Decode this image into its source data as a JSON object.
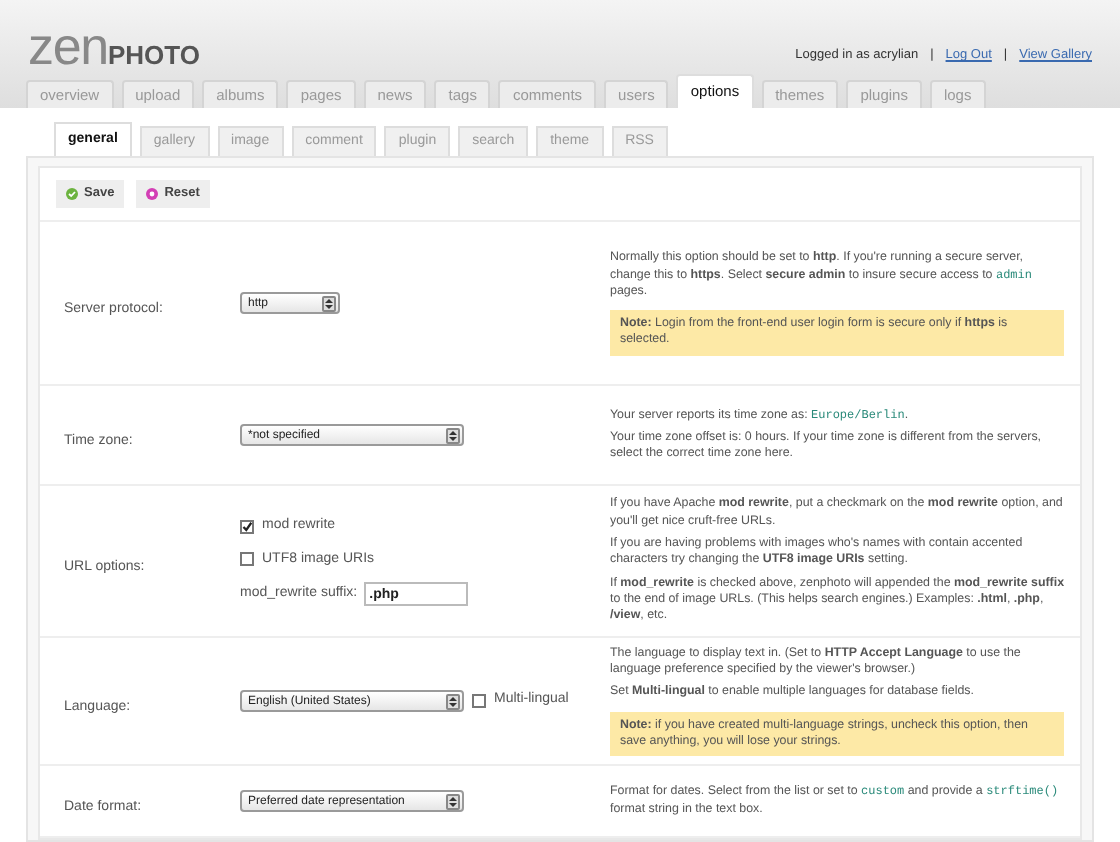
{
  "logo": {
    "part_1": "zen",
    "part_2": "PHOTO"
  },
  "user_bar": {
    "logged_in": "Logged in as acrylian",
    "separator_1": "|",
    "log_out": "Log Out",
    "separator_2": "|",
    "view_gallery": "View Gallery"
  },
  "tabs": [
    {
      "label": "overview",
      "selected": false
    },
    {
      "label": "upload",
      "selected": false
    },
    {
      "label": "albums",
      "selected": false
    },
    {
      "label": "pages",
      "selected": false
    },
    {
      "label": "news",
      "selected": false
    },
    {
      "label": "tags",
      "selected": false
    },
    {
      "label": "comments",
      "selected": false
    },
    {
      "label": "users",
      "selected": false
    },
    {
      "label": "options",
      "selected": true
    },
    {
      "label": "themes",
      "selected": false
    },
    {
      "label": "plugins",
      "selected": false
    },
    {
      "label": "logs",
      "selected": false
    }
  ],
  "subtabs": [
    {
      "label": "general",
      "selected": true
    },
    {
      "label": "gallery",
      "selected": false
    },
    {
      "label": "image",
      "selected": false
    },
    {
      "label": "comment",
      "selected": false
    },
    {
      "label": "plugin",
      "selected": false
    },
    {
      "label": "search",
      "selected": false
    },
    {
      "label": "theme",
      "selected": false
    },
    {
      "label": "RSS",
      "selected": false
    }
  ],
  "buttons": [
    {
      "label": "Save",
      "kind": "save"
    },
    {
      "label": "Reset",
      "kind": "reset"
    }
  ],
  "rows": [
    {
      "label": "Server protocol:",
      "controls": [
        {
          "kind": "select",
          "value": "http"
        }
      ],
      "description": [
        [
          {
            "kind": "text",
            "text": "Normally this option should be set to **http**. If you're running a secure server, change this to **https**. Select **secure admin** to insure secure access to "
          },
          {
            "kind": "code",
            "text": "admin"
          },
          {
            "kind": "text",
            "text": " pages."
          }
        ]
      ],
      "note": "**Note:** Login from the front-end user login form is secure only if **https** is selected."
    },
    {
      "label": "Time zone:",
      "controls": [
        {
          "kind": "select",
          "value": "*not specified"
        }
      ],
      "description": [
        [
          {
            "kind": "text",
            "text": "Your server reports its time zone as: "
          },
          {
            "kind": "code",
            "text": "Europe/Berlin"
          },
          {
            "kind": "text",
            "text": "."
          }
        ],
        [
          {
            "kind": "text",
            "text": "Your time zone offset is: 0 hours. If your time zone is different from the servers, select the correct time zone here."
          }
        ]
      ]
    },
    {
      "label": "URL options:",
      "controls": [
        {
          "kind": "checkbox",
          "label": "mod rewrite",
          "checked": true
        },
        {
          "kind": "checkbox",
          "label": "UTF8 image URIs",
          "checked": false
        },
        {
          "kind": "text",
          "label": "mod_rewrite suffix:",
          "value": ".php"
        }
      ],
      "description": [
        [
          {
            "kind": "text",
            "text": "If you have Apache **mod rewrite**, put a checkmark on the **mod rewrite** option, and you'll get nice cruft-free URLs."
          }
        ],
        [
          {
            "kind": "text",
            "text": "If you are having problems with images who's names with contain accented characters try changing the **UTF8 image URIs** setting."
          }
        ],
        [
          {
            "kind": "text",
            "text": "If **mod_rewrite** is checked above, zenphoto will appended the **mod_rewrite suffix** to the end of image URLs. (This helps search engines.) Examples: **.html**, **.php**, **/view**, etc."
          }
        ]
      ]
    },
    {
      "label": "Language:",
      "controls": [
        {
          "kind": "select",
          "value": "English (United States)"
        },
        {
          "kind": "checkbox",
          "label": "Multi-lingual",
          "checked": false
        }
      ],
      "description": [
        [
          {
            "kind": "text",
            "text": "The language to display text in. (Set to **HTTP Accept Language** to use the language preference specified by the viewer's browser.)"
          }
        ],
        [
          {
            "kind": "text",
            "text": "Set **Multi-lingual** to enable multiple languages for database fields."
          }
        ]
      ],
      "note": "**Note:** if you have created multi-language strings, uncheck this option, then save anything, you will lose your strings."
    },
    {
      "label": "Date format:",
      "controls": [
        {
          "kind": "select",
          "value": "Preferred date representation"
        }
      ],
      "description": [
        [
          {
            "kind": "text",
            "text": "Format for dates. Select from the list or set to "
          },
          {
            "kind": "code",
            "text": "custom"
          },
          {
            "kind": "text",
            "text": " and provide a "
          },
          {
            "kind": "code",
            "text": "strftime()"
          },
          {
            "kind": "text",
            "text": " format string in the text box."
          }
        ]
      ]
    }
  ]
}
